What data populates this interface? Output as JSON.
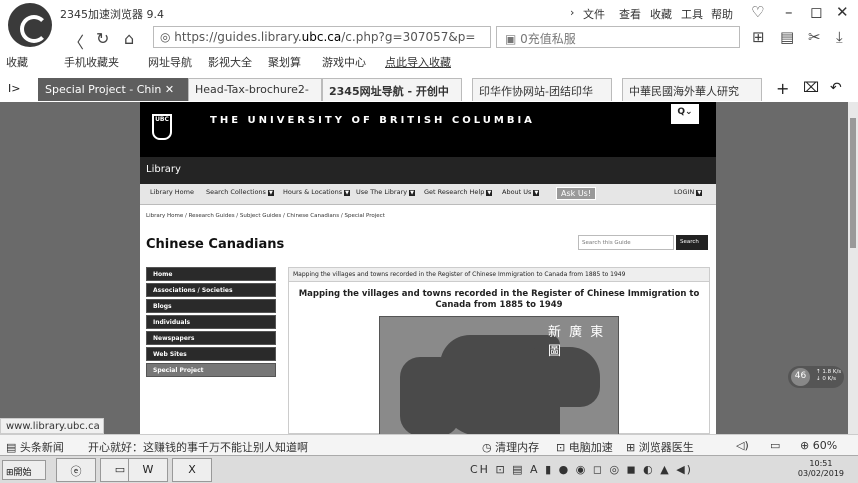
{
  "browser": {
    "title": "2345加速浏览器 9.4",
    "top_menu": [
      "文件",
      "查看",
      "收藏",
      "工具",
      "帮助"
    ],
    "url_prefix": "https://guides.library.",
    "url_domain": "ubc.ca",
    "url_suffix": "/c.php?g=307057&p=",
    "security_text": "0充值私服",
    "favorites": [
      "收藏",
      "手机收藏夹",
      "网址导航",
      "影视大全",
      "聚划算",
      "游戏中心",
      "点此导入收藏"
    ],
    "tabs": [
      {
        "label": "Special Project - Chin",
        "active": true
      },
      {
        "label": "Head-Tax-brochure2-",
        "active": false
      },
      {
        "label": "2345网址导航 - 开创中",
        "active": false
      },
      {
        "label": "印华作协网站-团结印华",
        "active": false
      },
      {
        "label": "中華民國海外華人研究",
        "active": false
      }
    ],
    "status_url": "www.library.ubc.ca"
  },
  "site": {
    "university": "THE UNIVERSITY OF BRITISH COLUMBIA",
    "crest_text": "UBC",
    "library_label": "Library",
    "nav": [
      "Library Home",
      "Search Collections",
      "Hours & Locations",
      "Use The Library",
      "Get Research Help",
      "About Us"
    ],
    "ask_us": "Ask Us!",
    "login": "LOGIN",
    "breadcrumb": "Library Home  /  Research Guides  /  Subject Guides  /  Chinese Canadians  /  Special Project",
    "guide_title": "Chinese Canadians",
    "search_placeholder": "Search this Guide",
    "search_button": "Search",
    "sidebar": [
      "Home",
      "Associations / Societies",
      "Blogs",
      "Individuals",
      "Newspapers",
      "Web Sites",
      "Special Project"
    ],
    "box_header": "Mapping the villages and towns recorded in the Register of Chinese Immigration to Canada from 1885 to 1949",
    "box_title": "Mapping the villages and towns recorded in the Register of Chinese Immigration to Canada from 1885 to 1949",
    "map_caption": "新 廣 東 圖"
  },
  "speed": {
    "percent": "46",
    "up": "↑ 1.8 K/s",
    "down": "↓ 0 K/s"
  },
  "statusbar": {
    "news": "头条新闻",
    "headline": "开心就好：这赚钱的事千万不能让别人知道啊",
    "items": [
      "清理内存",
      "电脑加速",
      "浏览器医生"
    ],
    "zoom": "60%"
  },
  "taskbar": {
    "start": "開始",
    "time": "10:51",
    "date": "03/02/2019"
  }
}
